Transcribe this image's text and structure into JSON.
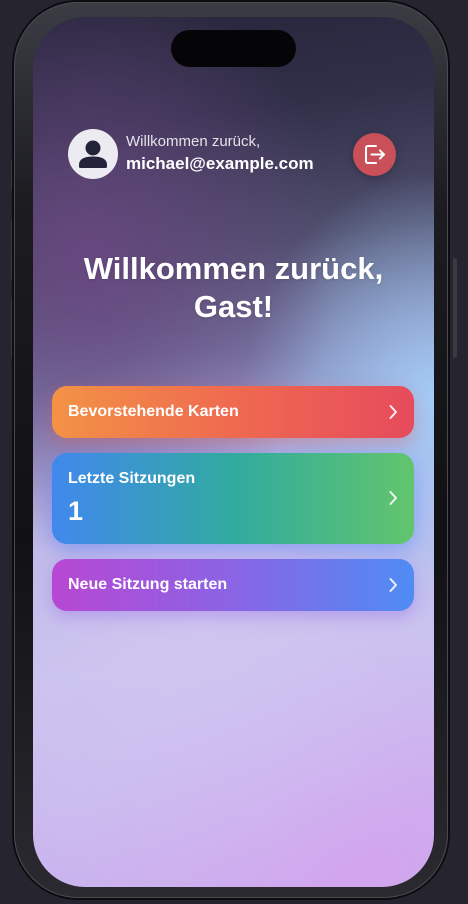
{
  "header": {
    "greeting": "Willkommen zurück,",
    "email": "michael@example.com",
    "avatar_icon": "person-icon",
    "logout_icon": "logout-icon"
  },
  "welcome": {
    "line1": "Willkommen zurück,",
    "line2": "Gast!"
  },
  "cards": {
    "upcoming": {
      "label": "Bevorstehende Karten"
    },
    "sessions": {
      "label": "Letzte Sitzungen",
      "count": "1"
    },
    "new_session": {
      "label": "Neue Sitzung starten"
    }
  },
  "colors": {
    "logout_button": "#c95058",
    "upcoming_gradient": [
      "#f39245",
      "#e64b5c"
    ],
    "sessions_gradient": [
      "#4188ee",
      "#62c56c"
    ],
    "new_session_gradient": [
      "#b747d3",
      "#4f8cf4"
    ]
  }
}
